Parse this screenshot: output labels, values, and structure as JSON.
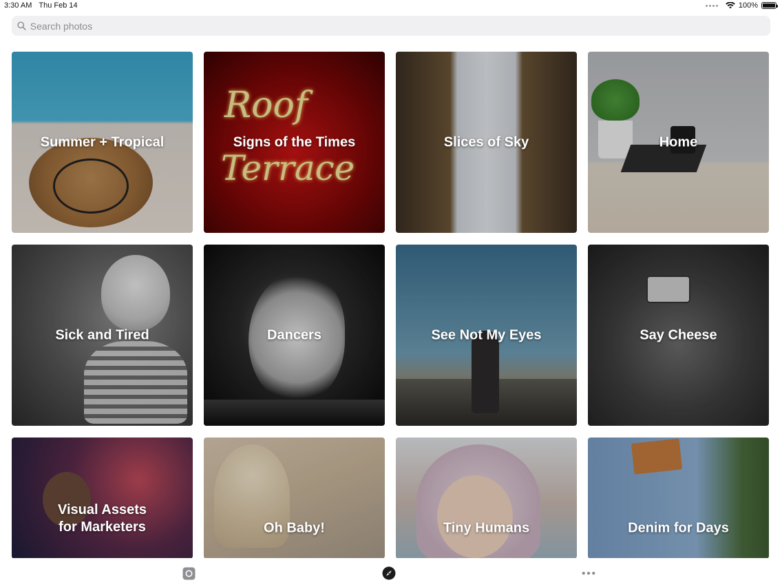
{
  "status_bar": {
    "time": "3:30 AM",
    "date": "Thu Feb 14",
    "battery": "100%"
  },
  "search": {
    "placeholder": "Search photos"
  },
  "collections": [
    {
      "title": "Summer + Tropical",
      "theme": "summer"
    },
    {
      "title": "Signs of the Times",
      "theme": "signs",
      "image_text": [
        "Roof",
        "Terrace"
      ]
    },
    {
      "title": "Slices of Sky",
      "theme": "sky"
    },
    {
      "title": "Home",
      "theme": "home"
    },
    {
      "title": "Sick and Tired",
      "theme": "sick"
    },
    {
      "title": "Dancers",
      "theme": "dancers"
    },
    {
      "title": "See Not My Eyes",
      "theme": "see"
    },
    {
      "title": "Say Cheese",
      "theme": "cheese"
    },
    {
      "title": "Visual Assets\nfor Marketers",
      "theme": "visual"
    },
    {
      "title": "Oh Baby!",
      "theme": "baby"
    },
    {
      "title": "Tiny Humans",
      "theme": "tiny"
    },
    {
      "title": "Denim for Days",
      "theme": "denim"
    }
  ],
  "tab_bar": {
    "items": [
      {
        "name": "photos",
        "icon": "photos-icon"
      },
      {
        "name": "explore",
        "icon": "compass-icon",
        "active": true
      },
      {
        "name": "more",
        "icon": "more-icon"
      }
    ]
  },
  "colors": {
    "search_bg": "#f0f0f2",
    "placeholder": "#8e8e93",
    "tab_inactive": "#8e8e93",
    "tab_active": "#1c1c1e"
  }
}
